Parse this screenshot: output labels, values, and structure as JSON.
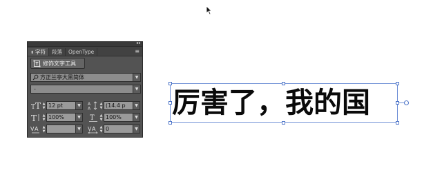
{
  "panel": {
    "tabs": [
      {
        "label": "字符"
      },
      {
        "label": "段落"
      },
      {
        "label": "OpenType"
      }
    ],
    "touch_type_button": "修饰文字工具",
    "font_family": "方正兰亭大黑简体",
    "font_style": "-",
    "font_size": "12 pt",
    "leading": "(14.4 p",
    "vertical_scale": "100%",
    "horizontal_scale": "100%",
    "kerning": "",
    "tracking": "0"
  },
  "canvas": {
    "headline": "厉害了，我的国"
  },
  "colors": {
    "panel_bg": "#535353",
    "selection": "#4b73c8"
  }
}
